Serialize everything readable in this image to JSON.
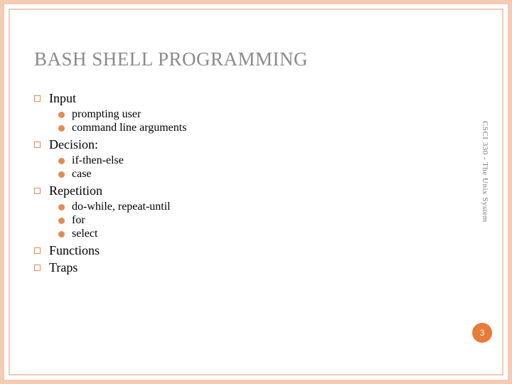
{
  "title": "BASH SHELL PROGRAMMING",
  "footer": "CSCI 330 - The Unix System",
  "page_number": "3",
  "items": [
    {
      "label": "Input",
      "subs": [
        "prompting user",
        "command line arguments"
      ]
    },
    {
      "label": "Decision:",
      "subs": [
        "if-then-else",
        "case"
      ]
    },
    {
      "label": "Repetition",
      "subs": [
        "do-while, repeat-until",
        "for",
        "select"
      ]
    },
    {
      "label": "Functions",
      "subs": []
    },
    {
      "label": "Traps",
      "subs": []
    }
  ]
}
